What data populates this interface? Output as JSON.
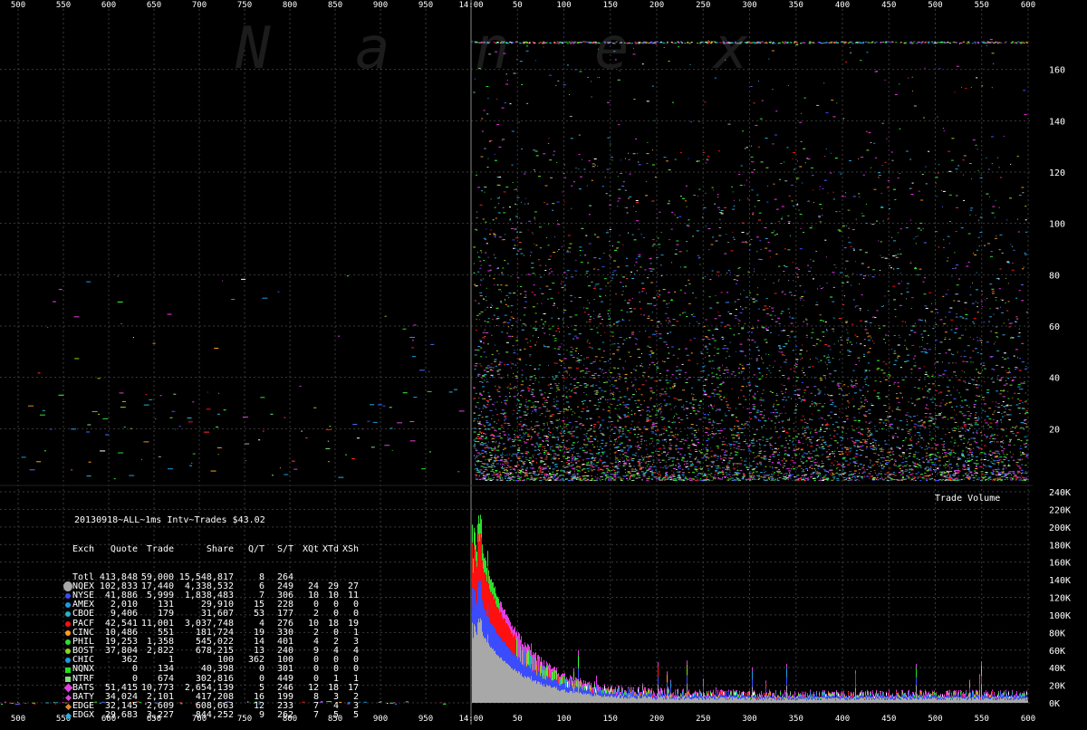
{
  "watermark": "Nanex",
  "chart_data": [
    {
      "type": "scatter",
      "name_hint": "top-left",
      "x_ticks": [
        500,
        550,
        600,
        650,
        700,
        750,
        800,
        850,
        900,
        950
      ],
      "xlim": [
        500,
        1000
      ],
      "grid": true
    },
    {
      "type": "scatter",
      "name_hint": "top-right",
      "x_ticks": [
        "14:00",
        "50",
        "100",
        "150",
        "200",
        "250",
        "300",
        "350",
        "400",
        "450",
        "500",
        "550",
        "600"
      ],
      "y_ticks": [
        20,
        40,
        60,
        80,
        100,
        120,
        140,
        160
      ],
      "ylim": [
        0,
        180
      ],
      "grid": true
    },
    {
      "type": "bar",
      "name_hint": "volume",
      "title": "Trade Volume",
      "y_ticks": [
        "0K",
        "20K",
        "40K",
        "60K",
        "80K",
        "100K",
        "120K",
        "140K",
        "160K",
        "180K",
        "200K",
        "220K",
        "240K"
      ],
      "ylim": [
        0,
        240000
      ],
      "x_ticks": [
        "14:00",
        "50",
        "100",
        "150",
        "200",
        "250",
        "300",
        "350",
        "400",
        "450",
        "500",
        "550",
        "600"
      ],
      "peak_value": 215000,
      "grid": true
    }
  ],
  "table": {
    "title": "20130918~ALL~1ms Intv~Trades $43.02",
    "headers": [
      "Exch",
      "Quote",
      "Trade",
      "Share",
      "Q/T",
      "S/T",
      "XQt",
      "XTd",
      "XSh"
    ],
    "rows": [
      {
        "exch": "Totl",
        "quote": "413,848",
        "trade": "59,000",
        "share": "15,548,817",
        "qt": "8",
        "st": "264",
        "xqt": "",
        "xtd": "",
        "xsh": "",
        "color": "",
        "shape": "none"
      },
      {
        "exch": "NQEX",
        "quote": "102,833",
        "trade": "17,440",
        "share": "4,338,532",
        "qt": "6",
        "st": "249",
        "xqt": "24",
        "xtd": "29",
        "xsh": "27",
        "color": "#a8a8a8",
        "shape": "big"
      },
      {
        "exch": "NYSE",
        "quote": "41,886",
        "trade": "5,999",
        "share": "1,838,483",
        "qt": "7",
        "st": "306",
        "xqt": "10",
        "xtd": "10",
        "xsh": "11",
        "color": "#3b4cff",
        "shape": "circle"
      },
      {
        "exch": "AMEX",
        "quote": "2,010",
        "trade": "131",
        "share": "29,910",
        "qt": "15",
        "st": "228",
        "xqt": "0",
        "xtd": "0",
        "xsh": "0",
        "color": "#1e9be0",
        "shape": "circle"
      },
      {
        "exch": "CBOE",
        "quote": "9,406",
        "trade": "179",
        "share": "31,607",
        "qt": "53",
        "st": "177",
        "xqt": "2",
        "xtd": "0",
        "xsh": "0",
        "color": "#2ab0c8",
        "shape": "circle"
      },
      {
        "exch": "PACF",
        "quote": "42,541",
        "trade": "11,001",
        "share": "3,037,748",
        "qt": "4",
        "st": "276",
        "xqt": "10",
        "xtd": "18",
        "xsh": "19",
        "color": "#ff1010",
        "shape": "circle"
      },
      {
        "exch": "CINC",
        "quote": "10,486",
        "trade": "551",
        "share": "181,724",
        "qt": "19",
        "st": "330",
        "xqt": "2",
        "xtd": "0",
        "xsh": "1",
        "color": "#ff9f1a",
        "shape": "circle"
      },
      {
        "exch": "PHIL",
        "quote": "19,253",
        "trade": "1,358",
        "share": "545,022",
        "qt": "14",
        "st": "401",
        "xqt": "4",
        "xtd": "2",
        "xsh": "3",
        "color": "#2ee02e",
        "shape": "circle"
      },
      {
        "exch": "BOST",
        "quote": "37,804",
        "trade": "2,822",
        "share": "678,215",
        "qt": "13",
        "st": "240",
        "xqt": "9",
        "xtd": "4",
        "xsh": "4",
        "color": "#8ad61a",
        "shape": "circle"
      },
      {
        "exch": "CHIC",
        "quote": "362",
        "trade": "1",
        "share": "100",
        "qt": "362",
        "st": "100",
        "xqt": "0",
        "xtd": "0",
        "xsh": "0",
        "color": "#1e9be0",
        "shape": "circle"
      },
      {
        "exch": "NQNX",
        "quote": "0",
        "trade": "134",
        "share": "40,398",
        "qt": "0",
        "st": "301",
        "xqt": "0",
        "xtd": "0",
        "xsh": "0",
        "color": "#22e022",
        "shape": "square"
      },
      {
        "exch": "NTRF",
        "quote": "0",
        "trade": "674",
        "share": "302,816",
        "qt": "0",
        "st": "449",
        "xqt": "0",
        "xtd": "1",
        "xsh": "1",
        "color": "#7ee07e",
        "shape": "square"
      },
      {
        "exch": "BATS",
        "quote": "51,415",
        "trade": "10,773",
        "share": "2,654,139",
        "qt": "5",
        "st": "246",
        "xqt": "12",
        "xtd": "18",
        "xsh": "17",
        "color": "#e040e0",
        "shape": "diamond"
      },
      {
        "exch": "BATY",
        "quote": "34,024",
        "trade": "2,101",
        "share": "417,208",
        "qt": "16",
        "st": "199",
        "xqt": "8",
        "xtd": "3",
        "xsh": "2",
        "color": "#e040e0",
        "shape": "diamond-s"
      },
      {
        "exch": "EDGE",
        "quote": "32,145",
        "trade": "2,609",
        "share": "608,663",
        "qt": "12",
        "st": "233",
        "xqt": "7",
        "xtd": "4",
        "xsh": "3",
        "color": "#e08a2a",
        "shape": "diamond-s"
      },
      {
        "exch": "EDGX",
        "quote": "29,683",
        "trade": "3,227",
        "share": "844,252",
        "qt": "9",
        "st": "262",
        "xqt": "7",
        "xtd": "5",
        "xsh": "5",
        "color": "#2ab0e0",
        "shape": "diamond-s"
      }
    ]
  }
}
